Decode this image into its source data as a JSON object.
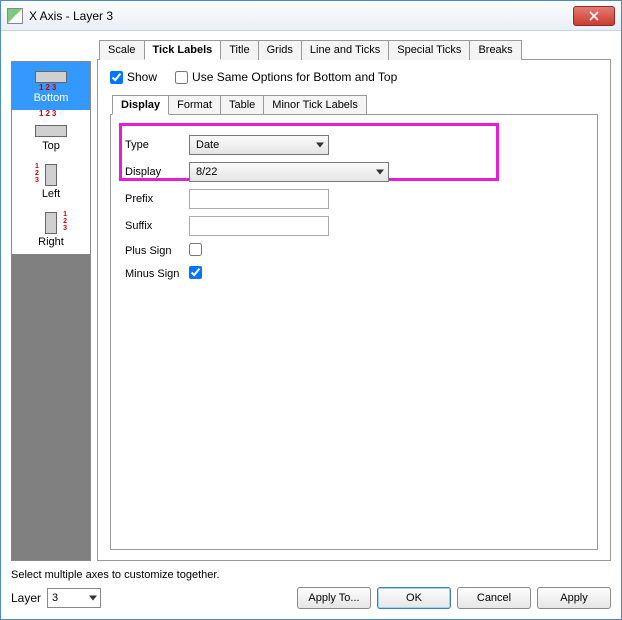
{
  "window": {
    "title": "X Axis - Layer 3"
  },
  "side": {
    "items": [
      {
        "label": "Bottom",
        "selected": true
      },
      {
        "label": "Top"
      },
      {
        "label": "Left"
      },
      {
        "label": "Right"
      }
    ]
  },
  "outer_tabs": [
    "Scale",
    "Tick Labels",
    "Title",
    "Grids",
    "Line and Ticks",
    "Special Ticks",
    "Breaks"
  ],
  "outer_active": "Tick Labels",
  "show": {
    "label": "Show",
    "checked": true
  },
  "same_opts": {
    "label": "Use Same Options for Bottom and Top",
    "checked": false
  },
  "inner_tabs": [
    "Display",
    "Format",
    "Table",
    "Minor Tick Labels"
  ],
  "inner_active": "Display",
  "form": {
    "type_label": "Type",
    "type_value": "Date",
    "display_label": "Display",
    "display_value": "8/22",
    "prefix_label": "Prefix",
    "prefix_value": "",
    "suffix_label": "Suffix",
    "suffix_value": "",
    "plus_label": "Plus Sign",
    "plus_checked": false,
    "minus_label": "Minus Sign",
    "minus_checked": true
  },
  "hint": "Select multiple axes to customize together.",
  "layer": {
    "label": "Layer",
    "value": "3"
  },
  "buttons": {
    "apply_to": "Apply To...",
    "ok": "OK",
    "cancel": "Cancel",
    "apply": "Apply"
  }
}
